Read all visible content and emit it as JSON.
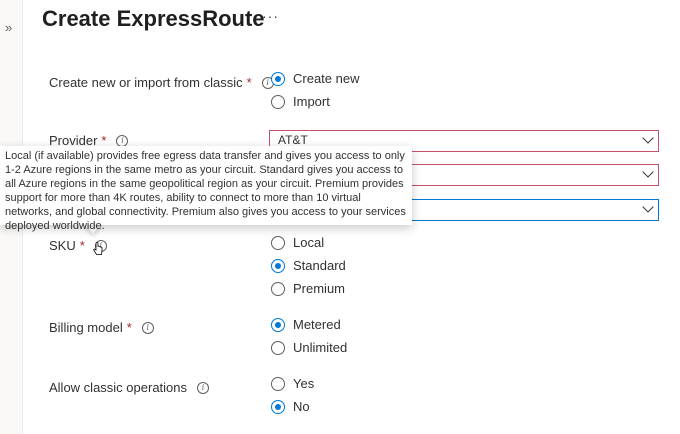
{
  "page": {
    "title": "Create ExpressRoute",
    "more": "···",
    "expand": "»"
  },
  "create_import": {
    "label": "Create new or import from classic",
    "options": [
      "Create new",
      "Import"
    ],
    "selected": "Create new"
  },
  "provider": {
    "label": "Provider",
    "value": "AT&T"
  },
  "tooltip": {
    "text": "Local (if available) provides free egress data transfer and gives you access to only 1-2 Azure regions in the same metro as your circuit. Standard gives you access to all Azure regions in the same geopolitical region as your circuit. Premium provides support for more than 4K routes, ability to connect to more than 10 virtual networks, and global connectivity. Premium also gives you access to your services deployed worldwide."
  },
  "sku": {
    "label": "SKU",
    "options": [
      "Local",
      "Standard",
      "Premium"
    ],
    "selected": "Standard"
  },
  "billing": {
    "label": "Billing model",
    "options": [
      "Metered",
      "Unlimited"
    ],
    "selected": "Metered"
  },
  "classic": {
    "label": "Allow classic operations",
    "options": [
      "Yes",
      "No"
    ],
    "selected": "No"
  },
  "required_marker": "*",
  "info_glyph": "i",
  "colors": {
    "accent": "#0078d4",
    "required": "#a4262c",
    "error_border": "#c8506a"
  }
}
